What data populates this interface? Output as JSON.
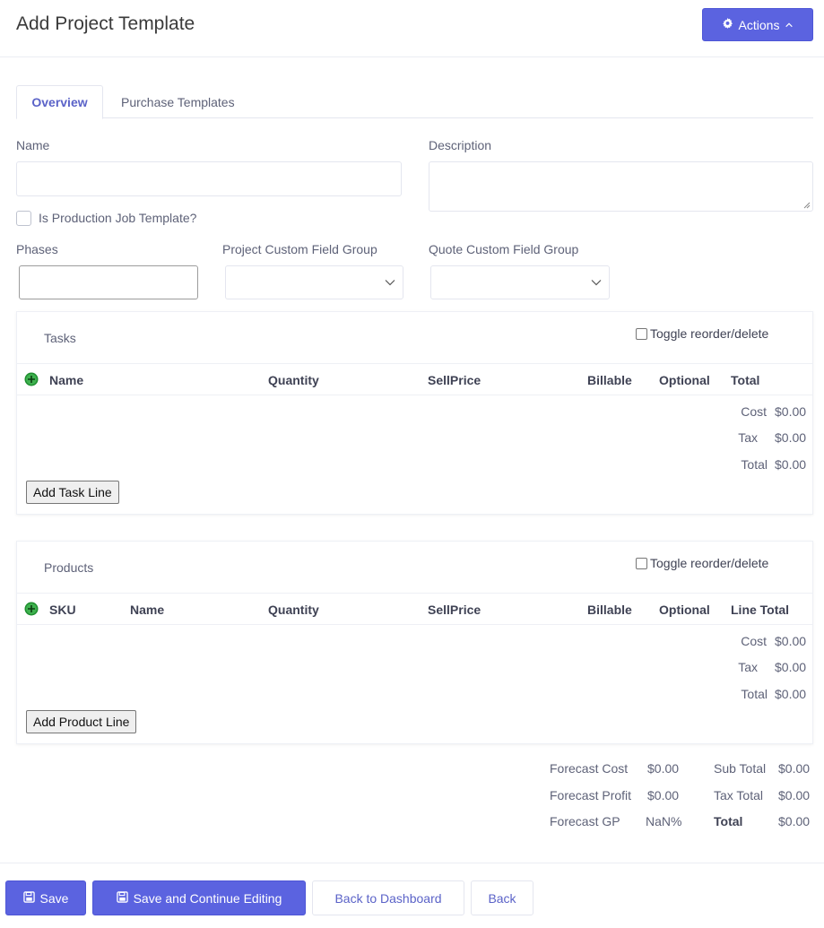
{
  "header": {
    "title": "Add Project Template",
    "actions_label": "Actions"
  },
  "tabs": [
    {
      "label": "Overview"
    },
    {
      "label": "Purchase Templates"
    }
  ],
  "form": {
    "name_label": "Name",
    "name_value": "",
    "description_label": "Description",
    "description_value": "",
    "production_label": "Is Production Job Template?",
    "phases_label": "Phases",
    "phases_value": "",
    "project_cfg_label": "Project Custom Field Group",
    "project_cfg_value": "",
    "quote_cfg_label": "Quote Custom Field Group",
    "quote_cfg_value": ""
  },
  "tasks": {
    "title": "Tasks",
    "toggle_label": "Toggle reorder/delete",
    "columns": [
      "Name",
      "Quantity",
      "SellPrice",
      "Billable",
      "Optional",
      "Total"
    ],
    "summary": [
      {
        "label": "Cost",
        "value": "$0.00"
      },
      {
        "label": "Tax",
        "value": "$0.00"
      },
      {
        "label": "Total",
        "value": "$0.00"
      }
    ],
    "add_label": "Add Task Line"
  },
  "products": {
    "title": "Products",
    "toggle_label": "Toggle reorder/delete",
    "columns": [
      "SKU",
      "Name",
      "Quantity",
      "SellPrice",
      "Billable",
      "Optional",
      "Line Total"
    ],
    "summary": [
      {
        "label": "Cost",
        "value": "$0.00"
      },
      {
        "label": "Tax",
        "value": "$0.00"
      },
      {
        "label": "Total",
        "value": "$0.00"
      }
    ],
    "add_label": "Add Product Line"
  },
  "totals": {
    "forecast_cost_label": "Forecast Cost",
    "forecast_cost_value": "$0.00",
    "forecast_profit_label": "Forecast Profit",
    "forecast_profit_value": "$0.00",
    "forecast_gp_label": "Forecast GP",
    "forecast_gp_value": "NaN%",
    "sub_total_label": "Sub Total",
    "sub_total_value": "$0.00",
    "tax_total_label": "Tax Total",
    "tax_total_value": "$0.00",
    "total_label": "Total",
    "total_value": "$0.00"
  },
  "footer": {
    "save_label": "Save",
    "save_continue_label": "Save and Continue Editing",
    "dashboard_label": "Back to Dashboard",
    "back_label": "Back"
  },
  "colors": {
    "primary": "#5b63e0",
    "tab_active": "#5b63c8",
    "add_icon": "#1e8e2f"
  },
  "icons": {
    "actions": "gear-icon",
    "actions_caret": "chevron-up-icon",
    "add": "plus-circle-icon",
    "save": "floppy-disk-icon"
  }
}
